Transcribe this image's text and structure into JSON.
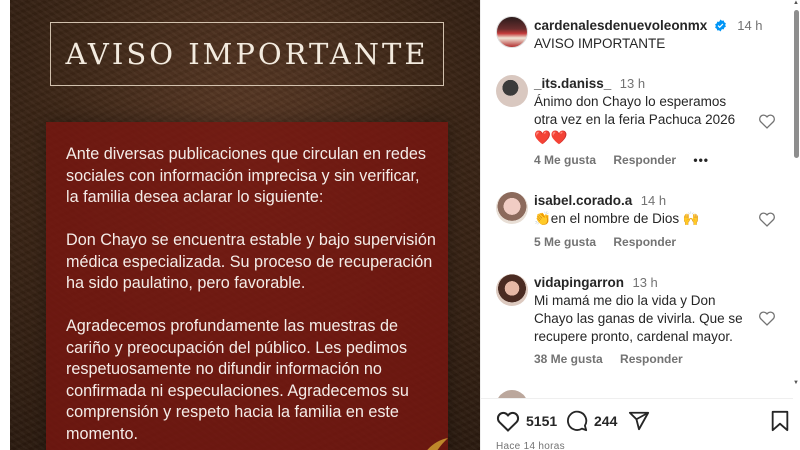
{
  "post_image": {
    "title": "AVISO IMPORTANTE",
    "paragraphs": [
      "Ante diversas publicaciones que circulan en redes sociales con información imprecisa y sin verificar, la familia desea aclarar lo siguiente:",
      "Don Chayo se encuentra estable y bajo supervisión médica especializada. Su proceso de recuperación ha sido paulatino, pero favorable.",
      "Agradecemos profundamente las muestras de cariño y preocupación del público. Les pedimos respetuosamente no difundir información no confirmada ni especulaciones. Agradecemos su comprensión y respeto hacia la familia en este momento."
    ],
    "colors": {
      "background": "#3e2717",
      "card": "#78160f",
      "text": "#f4ece8"
    }
  },
  "header": {
    "username": "cardenalesdenuevoleonmx",
    "time": "14 h",
    "caption": "AVISO IMPORTANTE",
    "verified_icon": "verified-badge-icon"
  },
  "comments": [
    {
      "username": "_its.daniss_",
      "time": "13 h",
      "text": "Ánimo don Chayo lo esperamos otra vez en la feria Pachuca 2026 ❤️❤️",
      "likes": "4 Me gusta",
      "reply": "Responder",
      "more": "•••"
    },
    {
      "username": "isabel.corado.a",
      "time": "14 h",
      "text": "👏en el nombre de Dios 🙌",
      "likes": "5 Me gusta",
      "reply": "Responder"
    },
    {
      "username": "vidapingarron",
      "time": "13 h",
      "text": "Mi mamá me dio la vida y Don Chayo las ganas de vivirla. Que se recupere pronto, cardenal mayor.",
      "likes": "38 Me gusta",
      "reply": "Responder"
    }
  ],
  "actions": {
    "likes_count": "5151",
    "comments_count": "244",
    "timestamp": "Hace 14 horas"
  },
  "icons": [
    "heart-icon",
    "comment-icon",
    "share-icon",
    "save-icon",
    "verified-badge-icon"
  ],
  "colors": {
    "text": "#262626",
    "muted": "#737373",
    "verified": "#0095f6",
    "like_red": "#ed4956"
  }
}
